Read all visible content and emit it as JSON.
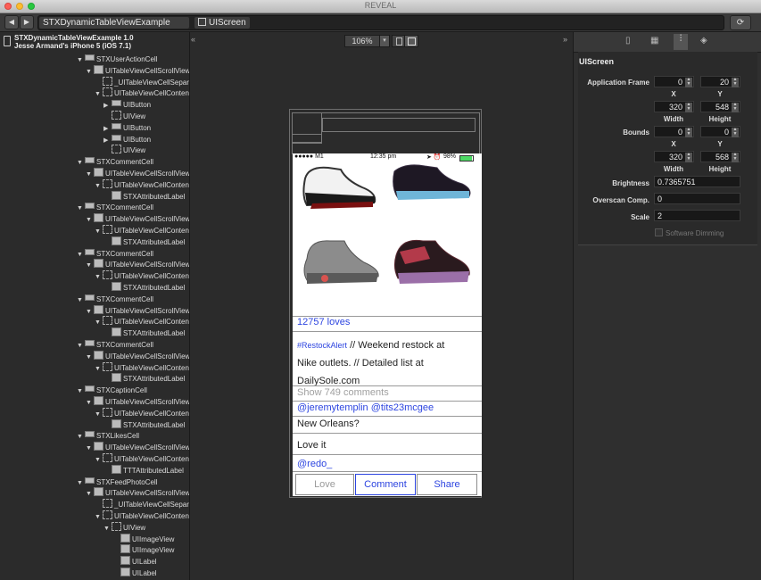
{
  "window": {
    "title": "REVEAL"
  },
  "toolbar": {
    "back_icon": "chevron-left-icon",
    "forward_icon": "chevron-right-icon",
    "breadcrumbs": [
      "STXDynamicTableViewExample (Jess...",
      "UIScreen"
    ],
    "refresh_icon": "refresh-icon"
  },
  "app": {
    "name": "STXDynamicTableViewExample 1.0",
    "device": "Jesse Armand's iPhone 5 (iOS 7.1)"
  },
  "tree": [
    {
      "label": "STXUserActionCell",
      "indent": 0,
      "open": true,
      "icon": "view"
    },
    {
      "label": "UITableViewCellScrollView",
      "indent": 1,
      "open": true,
      "icon": "scroll"
    },
    {
      "label": "_UITableViewCellSeparat",
      "indent": 2,
      "open": null,
      "icon": "dotted"
    },
    {
      "label": "UITableViewCellContent",
      "indent": 2,
      "open": true,
      "icon": "dotted"
    },
    {
      "label": "UIButton",
      "indent": 3,
      "open": false,
      "icon": "button"
    },
    {
      "label": "UIView",
      "indent": 3,
      "open": null,
      "icon": "dotted"
    },
    {
      "label": "UIButton",
      "indent": 3,
      "open": false,
      "icon": "button"
    },
    {
      "label": "UIButton",
      "indent": 3,
      "open": false,
      "icon": "button"
    },
    {
      "label": "UIView",
      "indent": 3,
      "open": null,
      "icon": "dotted"
    },
    {
      "label": "STXCommentCell",
      "indent": 0,
      "open": true,
      "icon": "view"
    },
    {
      "label": "UITableViewCellScrollView",
      "indent": 1,
      "open": true,
      "icon": "scroll"
    },
    {
      "label": "UITableViewCellContent",
      "indent": 2,
      "open": true,
      "icon": "dotted"
    },
    {
      "label": "STXAttributedLabel",
      "indent": 3,
      "open": null,
      "icon": "label"
    },
    {
      "label": "STXCommentCell",
      "indent": 0,
      "open": true,
      "icon": "view"
    },
    {
      "label": "UITableViewCellScrollView",
      "indent": 1,
      "open": true,
      "icon": "scroll"
    },
    {
      "label": "UITableViewCellContent",
      "indent": 2,
      "open": true,
      "icon": "dotted"
    },
    {
      "label": "STXAttributedLabel",
      "indent": 3,
      "open": null,
      "icon": "label"
    },
    {
      "label": "STXCommentCell",
      "indent": 0,
      "open": true,
      "icon": "view"
    },
    {
      "label": "UITableViewCellScrollView",
      "indent": 1,
      "open": true,
      "icon": "scroll"
    },
    {
      "label": "UITableViewCellContent",
      "indent": 2,
      "open": true,
      "icon": "dotted"
    },
    {
      "label": "STXAttributedLabel",
      "indent": 3,
      "open": null,
      "icon": "label"
    },
    {
      "label": "STXCommentCell",
      "indent": 0,
      "open": true,
      "icon": "view"
    },
    {
      "label": "UITableViewCellScrollView",
      "indent": 1,
      "open": true,
      "icon": "scroll"
    },
    {
      "label": "UITableViewCellContent",
      "indent": 2,
      "open": true,
      "icon": "dotted"
    },
    {
      "label": "STXAttributedLabel",
      "indent": 3,
      "open": null,
      "icon": "label"
    },
    {
      "label": "STXCommentCell",
      "indent": 0,
      "open": true,
      "icon": "view"
    },
    {
      "label": "UITableViewCellScrollView",
      "indent": 1,
      "open": true,
      "icon": "scroll"
    },
    {
      "label": "UITableViewCellContent",
      "indent": 2,
      "open": true,
      "icon": "dotted"
    },
    {
      "label": "STXAttributedLabel",
      "indent": 3,
      "open": null,
      "icon": "label"
    },
    {
      "label": "STXCaptionCell",
      "indent": 0,
      "open": true,
      "icon": "view"
    },
    {
      "label": "UITableViewCellScrollView",
      "indent": 1,
      "open": true,
      "icon": "scroll"
    },
    {
      "label": "UITableViewCellContent",
      "indent": 2,
      "open": true,
      "icon": "dotted"
    },
    {
      "label": "STXAttributedLabel",
      "indent": 3,
      "open": null,
      "icon": "label"
    },
    {
      "label": "STXLikesCell",
      "indent": 0,
      "open": true,
      "icon": "view"
    },
    {
      "label": "UITableViewCellScrollView",
      "indent": 1,
      "open": true,
      "icon": "scroll"
    },
    {
      "label": "UITableViewCellContent",
      "indent": 2,
      "open": true,
      "icon": "dotted"
    },
    {
      "label": "TTTAttributedLabel",
      "indent": 3,
      "open": null,
      "icon": "label"
    },
    {
      "label": "STXFeedPhotoCell",
      "indent": 0,
      "open": true,
      "icon": "view"
    },
    {
      "label": "UITableViewCellScrollView",
      "indent": 1,
      "open": true,
      "icon": "scroll"
    },
    {
      "label": "_UITableViewCellSeparat",
      "indent": 2,
      "open": null,
      "icon": "dotted"
    },
    {
      "label": "UITableViewCellContent",
      "indent": 2,
      "open": true,
      "icon": "dotted"
    },
    {
      "label": "UIView",
      "indent": 3,
      "open": true,
      "icon": "dotted"
    },
    {
      "label": "UIImageView",
      "indent": 4,
      "open": null,
      "icon": "image"
    },
    {
      "label": "UIImageView",
      "indent": 4,
      "open": null,
      "icon": "image"
    },
    {
      "label": "UILabel",
      "indent": 4,
      "open": null,
      "icon": "label"
    },
    {
      "label": "UILabel",
      "indent": 4,
      "open": null,
      "icon": "label"
    }
  ],
  "canvas": {
    "zoom": "106%"
  },
  "phone": {
    "carrier": "●●●●● M1",
    "time": "12:35 pm",
    "battery": "98%",
    "likes": "12757 loves",
    "caption_tag": "#RestockAlert",
    "caption_lines": [
      " // Weekend restock at",
      "Nike outlets. // Detailed list at",
      "DailySole.com"
    ],
    "show_comments": "Show 749 comments",
    "comments": [
      {
        "users": "@jeremytemplin @tits23mcgee",
        "text": "New Orleans?"
      },
      {
        "users": "",
        "text": "Love it"
      },
      {
        "users": "@redo_",
        "text": ""
      }
    ],
    "actions": [
      "Love",
      "Comment",
      "Share"
    ],
    "colors": {
      "link": "#2d45e0",
      "love_disabled": "#9a9a9a"
    }
  },
  "inspector": {
    "tab_icons": [
      "document-icon",
      "layout-icon",
      "sliders-icon",
      "layers-icon"
    ],
    "title": "UIScreen",
    "application_frame": {
      "label": "Application Frame",
      "x": "0",
      "y": "20",
      "w": "320",
      "h": "548"
    },
    "bounds": {
      "label": "Bounds",
      "x": "0",
      "y": "0",
      "w": "320",
      "h": "568"
    },
    "axis_labels": {
      "x": "X",
      "y": "Y",
      "width": "Width",
      "height": "Height"
    },
    "brightness": {
      "label": "Brightness",
      "value": "0.7365751"
    },
    "overscan": {
      "label": "Overscan Comp.",
      "value": "0"
    },
    "scale": {
      "label": "Scale",
      "value": "2"
    },
    "software_dimming": {
      "label": "Software Dimming",
      "checked": false
    }
  }
}
